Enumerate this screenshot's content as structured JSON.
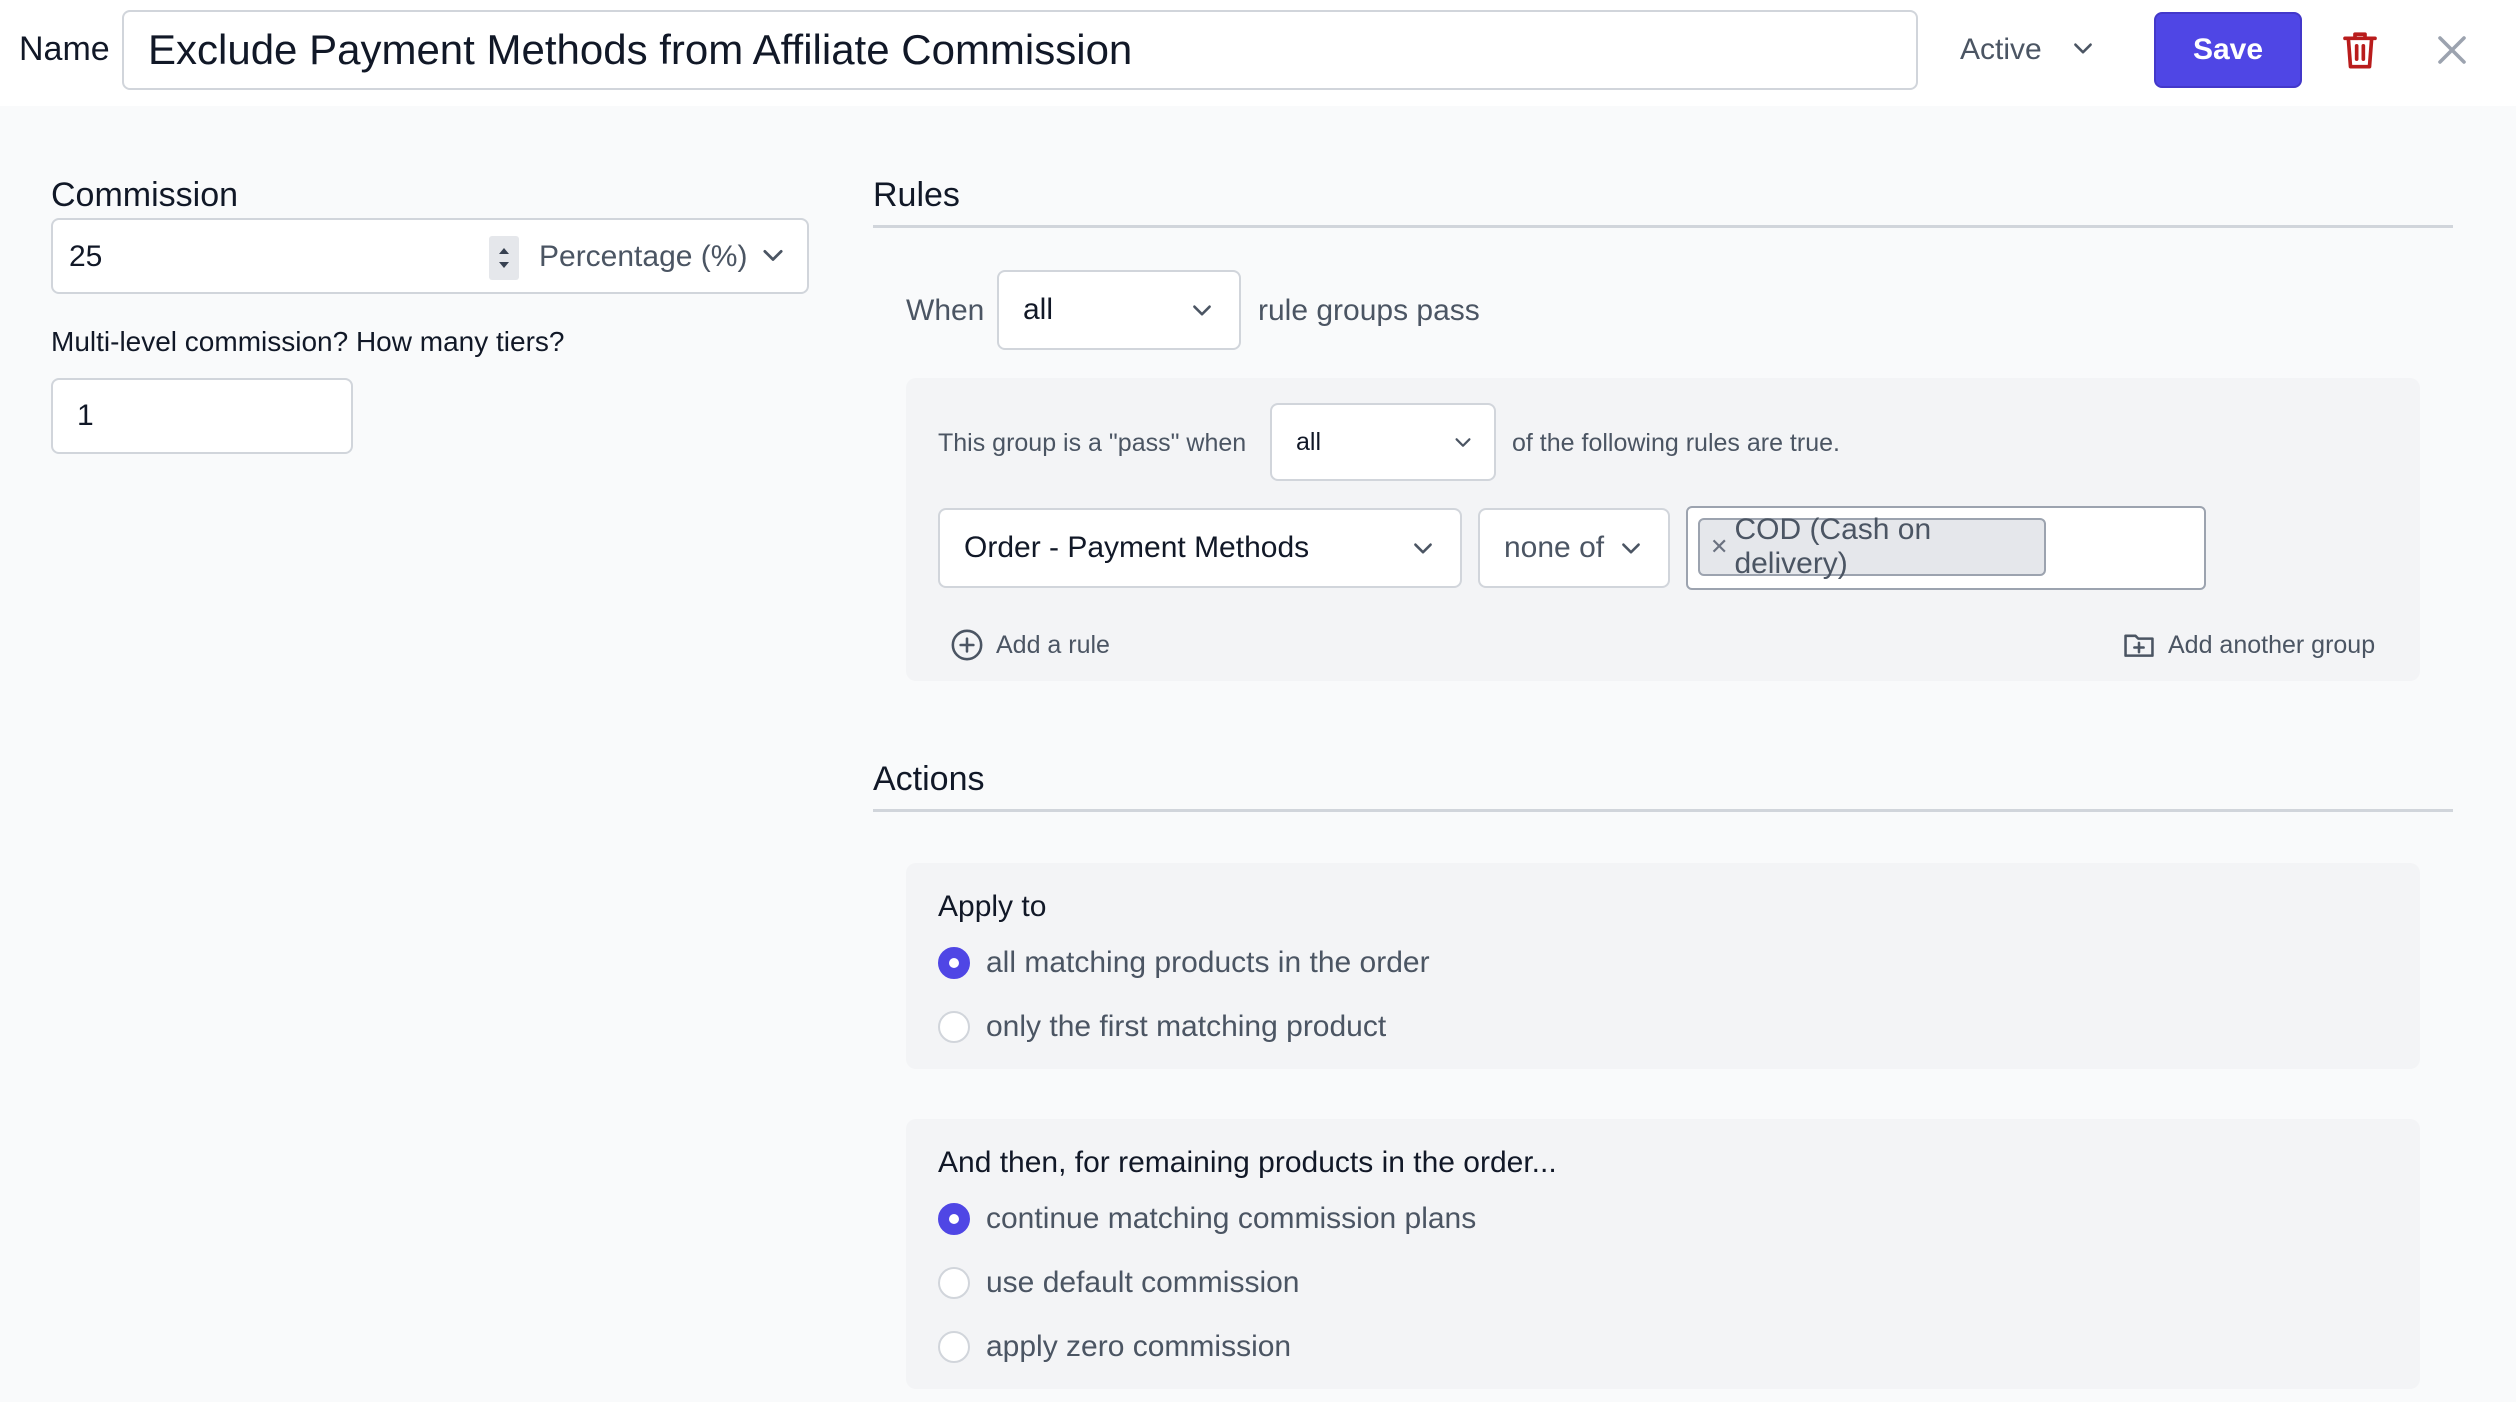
{
  "header": {
    "name_label": "Name",
    "name_value": "Exclude Payment Methods from Affiliate Commission",
    "status": "Active",
    "save_label": "Save"
  },
  "commission": {
    "label": "Commission",
    "value": "25",
    "type": "Percentage (%)",
    "tiers_label": "Multi-level commission? How many tiers?",
    "tiers_value": "1"
  },
  "rules": {
    "title": "Rules",
    "when_label": "When",
    "when_value": "all",
    "suffix": "rule groups pass",
    "group": {
      "prefix": "This group is a \"pass\" when",
      "match_value": "all",
      "suffix": "of the following rules are true.",
      "rule": {
        "field": "Order - Payment Methods",
        "operator": "none of",
        "values": [
          "COD (Cash on delivery)"
        ]
      },
      "add_rule": "Add a rule",
      "add_group": "Add another group"
    }
  },
  "actions": {
    "title": "Actions",
    "apply_to": {
      "title": "Apply to",
      "options": [
        "all matching products in the order",
        "only the first matching product"
      ],
      "selected": 0
    },
    "remaining": {
      "title": "And then, for remaining products in the order...",
      "options": [
        "continue matching commission plans",
        "use default commission",
        "apply zero commission"
      ],
      "selected": 0
    }
  },
  "colors": {
    "accent": "#4f46e5",
    "danger": "#b91c1c",
    "background": "#f9fafb",
    "panel": "#f3f4f6"
  },
  "icons": {
    "status_dropdown": "chevron-down-icon",
    "delete": "trash-icon",
    "close": "close-icon",
    "add_rule": "plus-circle-icon",
    "add_group": "folder-plus-icon"
  }
}
